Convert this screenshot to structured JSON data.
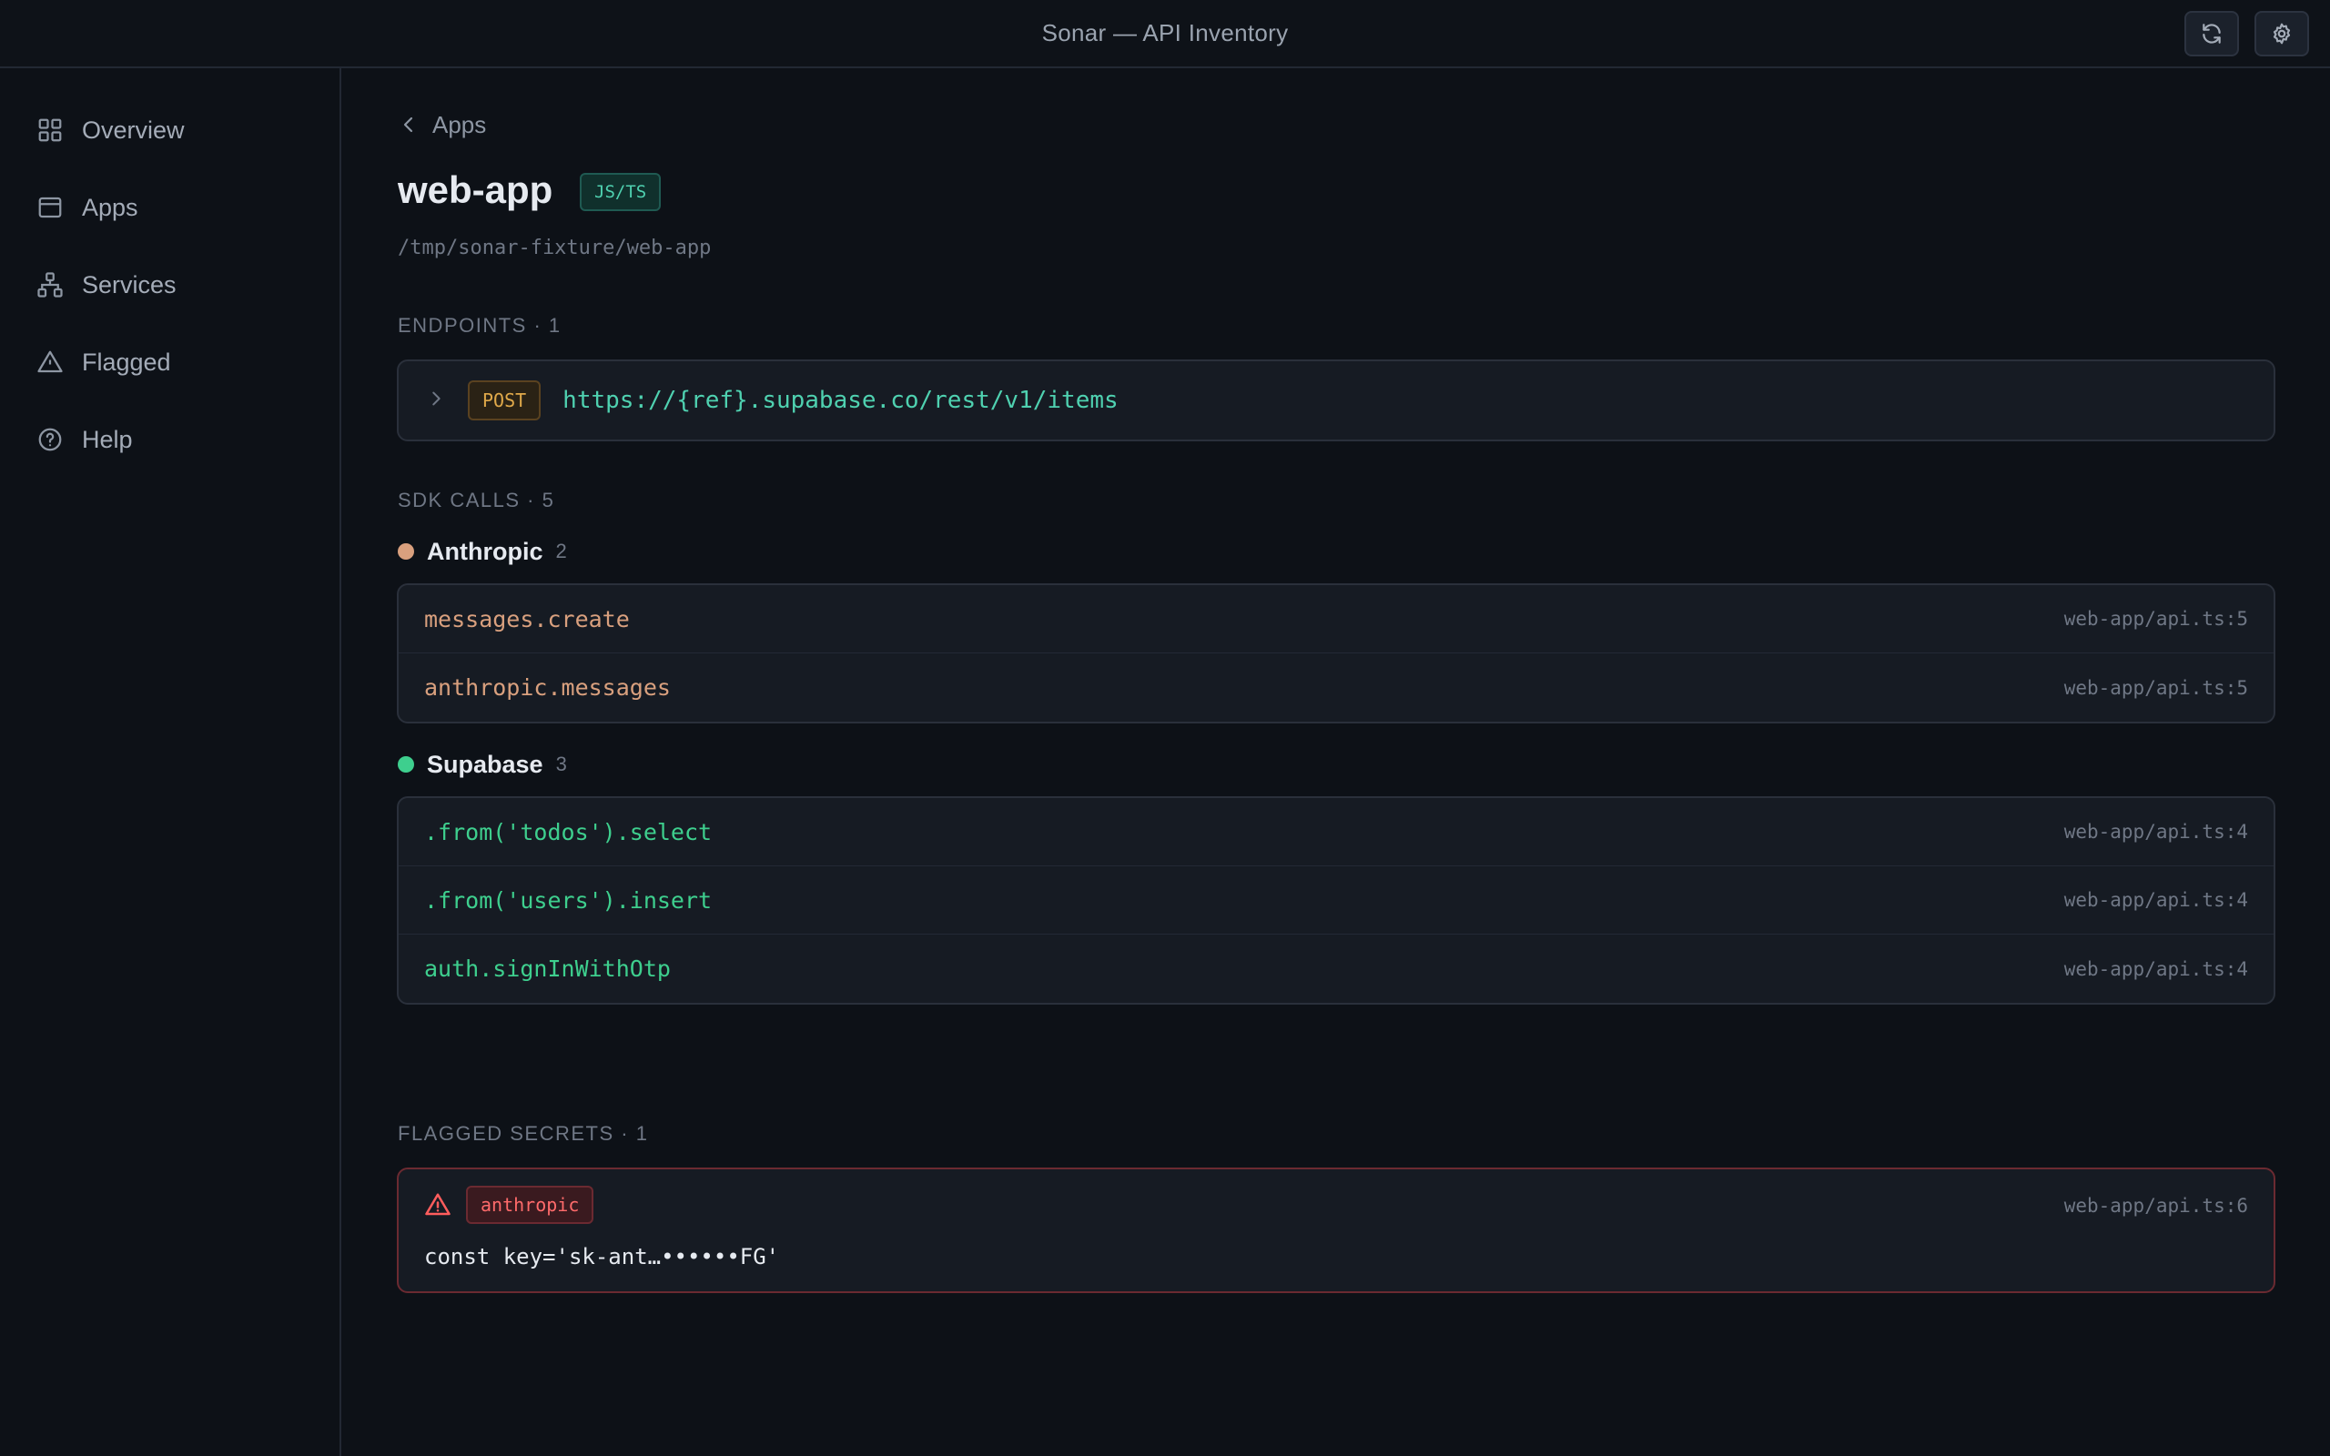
{
  "window": {
    "title": "Sonar — API Inventory"
  },
  "toolbar": {
    "refresh_icon": "refresh-icon",
    "settings_icon": "gear-icon"
  },
  "sidebar": {
    "items": [
      {
        "label": "Overview",
        "icon": "grid-icon"
      },
      {
        "label": "Apps",
        "icon": "window-icon"
      },
      {
        "label": "Services",
        "icon": "network-icon"
      },
      {
        "label": "Flagged",
        "icon": "warning-icon"
      },
      {
        "label": "Help",
        "icon": "help-icon"
      }
    ]
  },
  "main": {
    "back_label": "Apps",
    "app_name": "web-app",
    "language": "JS/TS",
    "path": "/tmp/sonar-fixture/web-app",
    "endpoints": {
      "label": "ENDPOINTS · 1",
      "items": [
        {
          "method": "POST",
          "url": "https://{ref}.supabase.co/rest/v1/items"
        }
      ]
    },
    "sdk_calls": {
      "label": "SDK CALLS · 5",
      "groups": [
        {
          "name": "Anthropic",
          "count": "2",
          "color": "#d9a07e",
          "calls": [
            {
              "name": "messages.create",
              "location": "web-app/api.ts:5"
            },
            {
              "name": "anthropic.messages",
              "location": "web-app/api.ts:5"
            }
          ]
        },
        {
          "name": "Supabase",
          "count": "3",
          "color": "#3ecf8e",
          "calls": [
            {
              "name": ".from('todos').select",
              "location": "web-app/api.ts:4"
            },
            {
              "name": ".from('users').insert",
              "location": "web-app/api.ts:4"
            },
            {
              "name": "auth.signInWithOtp",
              "location": "web-app/api.ts:4"
            }
          ]
        }
      ]
    },
    "flagged_secrets": {
      "label": "FLAGGED SECRETS · 1",
      "items": [
        {
          "provider": "anthropic",
          "location": "web-app/api.ts:6",
          "code": "const key='sk-ant…••••••FG'"
        }
      ]
    }
  }
}
